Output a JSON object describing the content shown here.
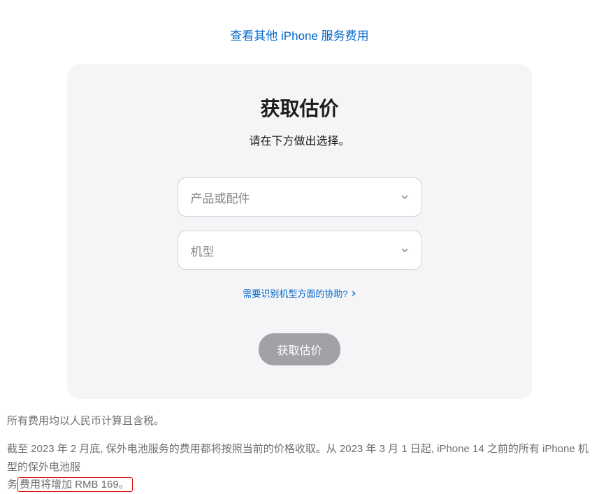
{
  "topLink": {
    "label": "查看其他 iPhone 服务费用"
  },
  "card": {
    "title": "获取估价",
    "subtitle": "请在下方做出选择。",
    "select1": {
      "placeholder": "产品或配件"
    },
    "select2": {
      "placeholder": "机型"
    },
    "helpLink": {
      "label": "需要识别机型方面的协助?"
    },
    "submit": {
      "label": "获取估价"
    }
  },
  "footer": {
    "line1": "所有费用均以人民币计算且含税。",
    "line2_part1": "截至 2023 年 2 月底, 保外电池服务的费用都将按照当前的价格收取。从 2023 年 3 月 1 日起, iPhone 14 之前的所有 iPhone 机型的保外电池服",
    "line2_part2": "务",
    "line2_highlight": "费用将增加 RMB 169。"
  }
}
